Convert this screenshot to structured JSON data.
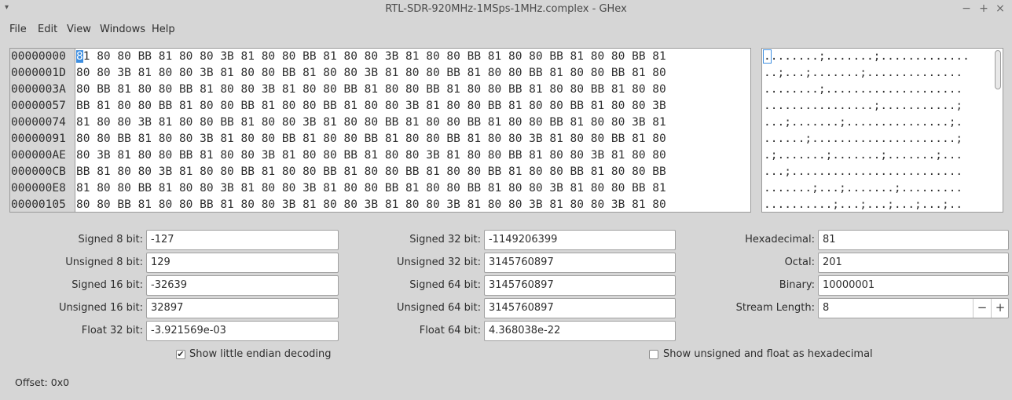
{
  "window": {
    "title": "RTL-SDR-920MHz-1MSps-1MHz.complex - GHex",
    "minimize_glyph": "−",
    "maximize_glyph": "+",
    "close_glyph": "×",
    "menu_glyph": "▾"
  },
  "menu": [
    "File",
    "Edit",
    "View",
    "Windows",
    "Help"
  ],
  "hex": {
    "offsets": [
      "00000000",
      "0000001D",
      "0000003A",
      "00000057",
      "00000074",
      "00000091",
      "000000AE",
      "000000CB",
      "000000E8",
      "00000105"
    ],
    "cursor_char": "8",
    "first_row_rest": "1 80 80 BB 81 80 80 3B 81 80 80 BB 81 80 80 3B 81 80 80 BB 81 80 80 BB 81 80 80 BB 81",
    "rows": [
      "",
      "80 80 3B 81 80 80 3B 81 80 80 BB 81 80 80 3B 81 80 80 BB 81 80 80 BB 81 80 80 BB 81 80",
      "80 BB 81 80 80 BB 81 80 80 3B 81 80 80 BB 81 80 80 BB 81 80 80 BB 81 80 80 BB 81 80 80",
      "BB 81 80 80 BB 81 80 80 BB 81 80 80 BB 81 80 80 3B 81 80 80 BB 81 80 80 BB 81 80 80 3B",
      "81 80 80 3B 81 80 80 BB 81 80 80 3B 81 80 80 BB 81 80 80 BB 81 80 80 BB 81 80 80 3B 81",
      "80 80 BB 81 80 80 3B 81 80 80 BB 81 80 80 BB 81 80 80 BB 81 80 80 3B 81 80 80 BB 81 80",
      "80 3B 81 80 80 BB 81 80 80 3B 81 80 80 BB 81 80 80 3B 81 80 80 BB 81 80 80 3B 81 80 80",
      "BB 81 80 80 3B 81 80 80 BB 81 80 80 BB 81 80 80 BB 81 80 80 BB 81 80 80 BB 81 80 80 BB",
      "81 80 80 BB 81 80 80 3B 81 80 80 3B 81 80 80 BB 81 80 80 BB 81 80 80 3B 81 80 80 BB 81",
      "80 80 BB 81 80 80 BB 81 80 80 3B 81 80 80 3B 81 80 80 3B 81 80 80 3B 81 80 80 3B 81 80"
    ]
  },
  "ascii": {
    "cursor_char": ".",
    "first_row_rest": ".......;.......;.............",
    "rows": [
      "",
      "..;...;.......;..............",
      "........;....................",
      "................;...........;",
      "...;.......;...............;.",
      "......;.....................;",
      ".;.......;.......;.......;...",
      "...;.........................",
      ".......;...;.......;.........",
      "..........;...;...;...;...;.."
    ]
  },
  "decoder": {
    "signed8_label": "Signed 8 bit:",
    "signed8": "-127",
    "unsigned8_label": "Unsigned 8 bit:",
    "unsigned8": "129",
    "signed16_label": "Signed 16 bit:",
    "signed16": "-32639",
    "unsigned16_label": "Unsigned 16 bit:",
    "unsigned16": "32897",
    "float32_label": "Float 32 bit:",
    "float32": "-3.921569e-03",
    "signed32_label": "Signed 32 bit:",
    "signed32": "-1149206399",
    "unsigned32_label": "Unsigned 32 bit:",
    "unsigned32": "3145760897",
    "signed64_label": "Signed 64 bit:",
    "signed64": "3145760897",
    "unsigned64_label": "Unsigned 64 bit:",
    "unsigned64": "3145760897",
    "float64_label": "Float 64 bit:",
    "float64": "4.368038e-22",
    "hex_label": "Hexadecimal:",
    "hex": "81",
    "octal_label": "Octal:",
    "octal": "201",
    "binary_label": "Binary:",
    "binary": "10000001",
    "stream_label": "Stream Length:",
    "stream": "8",
    "minus_glyph": "−",
    "plus_glyph": "+"
  },
  "options": {
    "little_endian_label": "Show little endian decoding",
    "little_endian_checked": true,
    "check_glyph": "✔",
    "unsigned_hex_label": "Show unsigned and float as hexadecimal",
    "unsigned_hex_checked": false
  },
  "status": {
    "offset": "Offset: 0x0"
  }
}
